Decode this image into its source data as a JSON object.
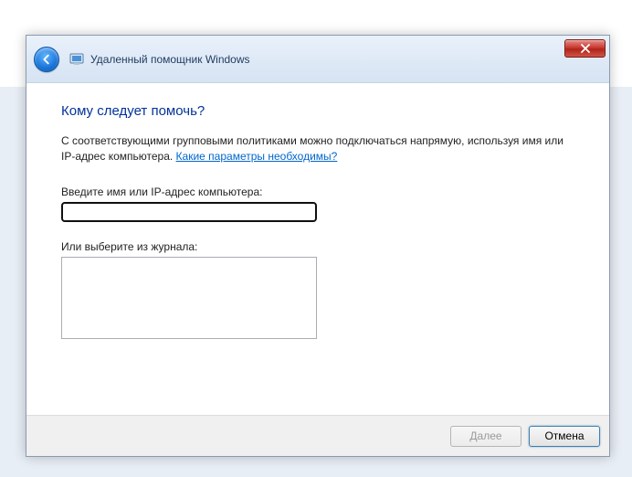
{
  "titlebar": {
    "app_title": "Удаленный помощник Windows"
  },
  "content": {
    "heading": "Кому следует помочь?",
    "description_part1": "С соответствующими групповыми политиками можно подключаться напрямую, используя имя или IP-адрес компьютера. ",
    "help_link": "Какие параметры необходимы?",
    "input_label": "Введите имя или IP-адрес компьютера:",
    "input_value": "",
    "history_label": "Или выберите из журнала:"
  },
  "footer": {
    "next": "Далее",
    "cancel": "Отмена"
  }
}
